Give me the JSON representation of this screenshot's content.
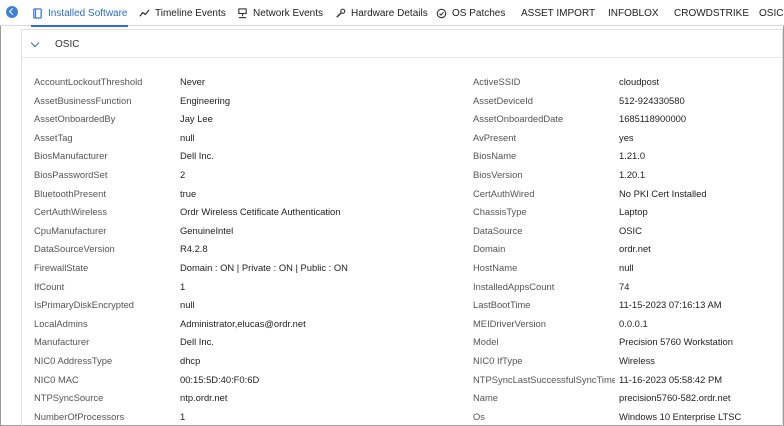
{
  "tabs": [
    {
      "label": "Installed Software",
      "icon": "book-icon"
    },
    {
      "label": "Timeline Events",
      "icon": "trend-icon"
    },
    {
      "label": "Network Events",
      "icon": "network-icon"
    },
    {
      "label": "Hardware Details",
      "icon": "wrench-icon"
    },
    {
      "label": "OS Patches",
      "icon": "check-circle-icon"
    },
    {
      "label": "ASSET IMPORT"
    },
    {
      "label": "INFOBLOX"
    },
    {
      "label": "CROWDSTRIKE"
    },
    {
      "label": "OSIC"
    }
  ],
  "active_tab": "Installed Software",
  "accent_color": "#2a6fc9",
  "section": {
    "title": "OSIC"
  },
  "rows": [
    {
      "k1": "AccountLockoutThreshold",
      "v1": "Never",
      "k2": "ActiveSSID",
      "v2": "cloudpost"
    },
    {
      "k1": "AssetBusinessFunction",
      "v1": "Engineering",
      "k2": "AssetDeviceId",
      "v2": "512-924330580"
    },
    {
      "k1": "AssetOnboardedBy",
      "v1": "Jay Lee",
      "k2": "AssetOnboardedDate",
      "v2": "1685118900000"
    },
    {
      "k1": "AssetTag",
      "v1": "null",
      "k2": "AvPresent",
      "v2": "yes"
    },
    {
      "k1": "BiosManufacturer",
      "v1": "Dell Inc.",
      "k2": "BiosName",
      "v2": "1.21.0"
    },
    {
      "k1": "BiosPasswordSet",
      "v1": "2",
      "k2": "BiosVersion",
      "v2": "1.20.1"
    },
    {
      "k1": "BluetoothPresent",
      "v1": "true",
      "k2": "CertAuthWired",
      "v2": "No PKI Cert Installed"
    },
    {
      "k1": "CertAuthWireless",
      "v1": "Ordr Wireless Cetificate Authentication",
      "k2": "ChassisType",
      "v2": "Laptop"
    },
    {
      "k1": "CpuManufacturer",
      "v1": "GenuineIntel",
      "k2": "DataSource",
      "v2": "OSIC"
    },
    {
      "k1": "DataSourceVersion",
      "v1": "R4.2.8",
      "k2": "Domain",
      "v2": "ordr.net"
    },
    {
      "k1": "FirewallState",
      "v1": "Domain : ON | Private : ON | Public : ON",
      "k2": "HostName",
      "v2": "null"
    },
    {
      "k1": "IfCount",
      "v1": "1",
      "k2": "InstalledAppsCount",
      "v2": "74"
    },
    {
      "k1": "IsPrimaryDiskEncrypted",
      "v1": "null",
      "k2": "LastBootTime",
      "v2": "11-15-2023 07:16:13 AM"
    },
    {
      "k1": "LocalAdmins",
      "v1": "Administrator,elucas@ordr.net",
      "k2": "MEIDriverVersion",
      "v2": "0.0.0.1"
    },
    {
      "k1": "Manufacturer",
      "v1": "Dell Inc.",
      "k2": "Model",
      "v2": "Precision 5760 Workstation"
    },
    {
      "k1": "NIC0 AddressType",
      "v1": "dhcp",
      "k2": "NIC0 IfType",
      "v2": "Wireless"
    },
    {
      "k1": "NIC0 MAC",
      "v1": "00:15:5D:40:F0:6D",
      "k2": "NTPSyncLastSuccessfulSyncTime",
      "v2": "11-16-2023 05:58:42 PM"
    },
    {
      "k1": "NTPSyncSource",
      "v1": "ntp.ordr.net",
      "k2": "Name",
      "v2": "precision5760-582.ordr.net"
    },
    {
      "k1": "NumberOfProcessors",
      "v1": "1",
      "k2": "Os",
      "v2": "Windows 10 Enterprise LTSC"
    }
  ]
}
